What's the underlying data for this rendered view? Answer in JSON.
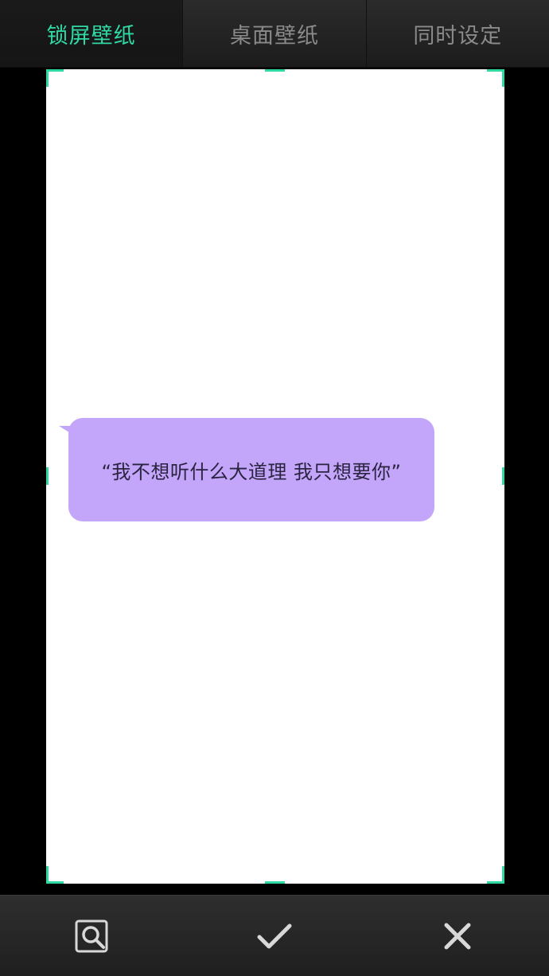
{
  "tabs": [
    {
      "label": "锁屏壁纸",
      "active": true
    },
    {
      "label": "桌面壁纸",
      "active": false
    },
    {
      "label": "同时设定",
      "active": false
    }
  ],
  "preview": {
    "bubble_text": "“我不想听什么大道理  我只想要你”",
    "bubble_color": "#c3a5fa",
    "background_color": "#ffffff"
  },
  "accent_color": "#2fd9a4",
  "toolbar": {
    "buttons": [
      {
        "icon": "zoom-preview-icon"
      },
      {
        "icon": "checkmark-icon"
      },
      {
        "icon": "close-icon"
      }
    ]
  }
}
